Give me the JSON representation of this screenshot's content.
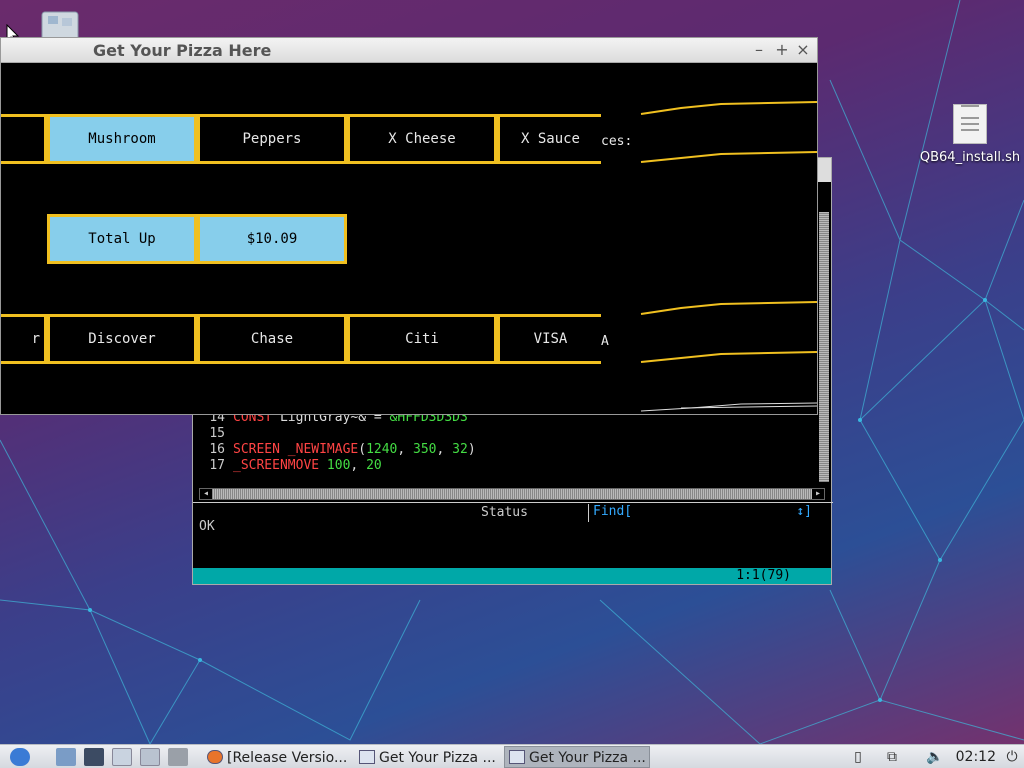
{
  "desktop": {
    "file_icon_label": "QB64_install.sh"
  },
  "pizza_window": {
    "title": "Get Your Pizza Here",
    "controls": {
      "minimize": "–",
      "maximize": "+",
      "close": "×"
    },
    "toppings": [
      "Mushroom",
      "Peppers",
      "X Cheese",
      "X Sauce"
    ],
    "total": {
      "label": "Total Up",
      "value": "$10.09"
    },
    "payments": [
      "r",
      "Discover",
      "Chase",
      "Citi",
      "VISA"
    ],
    "trail_text_1": "ces:",
    "trail_text_2": "A"
  },
  "ide": {
    "code_lines": [
      {
        "n": "14",
        "parts": [
          [
            "kw",
            "CONST"
          ],
          [
            "id",
            " LightGray~& = "
          ],
          [
            "num",
            "&HFFD3D3D3"
          ]
        ]
      },
      {
        "n": "15",
        "parts": []
      },
      {
        "n": "16",
        "parts": [
          [
            "kw",
            "SCREEN _NEWIMAGE"
          ],
          [
            "id",
            "("
          ],
          [
            "num",
            "1240"
          ],
          [
            "id",
            ", "
          ],
          [
            "num",
            "350"
          ],
          [
            "id",
            ", "
          ],
          [
            "num",
            "32"
          ],
          [
            "id",
            ")"
          ]
        ]
      },
      {
        "n": "17",
        "parts": [
          [
            "kw",
            "_SCREENMOVE"
          ],
          [
            "id",
            " "
          ],
          [
            "num",
            "100"
          ],
          [
            "id",
            ", "
          ],
          [
            "num",
            "20"
          ]
        ]
      }
    ],
    "status_title": "Status",
    "find_label": "Find[",
    "find_arrows": "↕]",
    "status_text": "OK",
    "cursor_position": "1:1(79)"
  },
  "taskbar": {
    "tasks": [
      {
        "label": "[Release Versio...",
        "active": false
      },
      {
        "label": "Get Your Pizza ...",
        "active": false
      },
      {
        "label": "Get Your Pizza ...",
        "active": true
      }
    ],
    "clock": "02:12"
  }
}
